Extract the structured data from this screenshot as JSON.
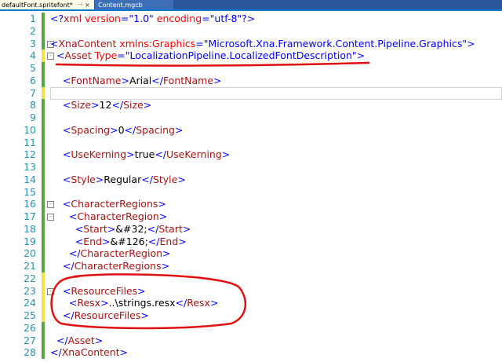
{
  "tabs": [
    {
      "label": "defaultFont.spritefont*",
      "pin": "⊣",
      "close": "×",
      "active": true
    },
    {
      "label": "Content.mgcb",
      "active": false
    }
  ],
  "lines": [
    {
      "n": "1",
      "mark": "saved",
      "parts": [
        [
          "b",
          "<?"
        ],
        [
          "t",
          "xml"
        ],
        [
          "a",
          " version"
        ],
        [
          "b",
          "="
        ],
        [
          "v",
          "\"1.0\""
        ],
        [
          "a",
          " encoding"
        ],
        [
          "b",
          "="
        ],
        [
          "v",
          "\"utf-8\""
        ],
        [
          "b",
          "?>"
        ]
      ]
    },
    {
      "n": "2",
      "mark": "saved",
      "parts": []
    },
    {
      "n": "3",
      "mark": "saved",
      "fold": "-",
      "parts": [
        [
          "b",
          "<"
        ],
        [
          "t",
          "XnaContent"
        ],
        [
          "a",
          " xmlns:Graphics"
        ],
        [
          "b",
          "="
        ],
        [
          "v",
          "\"Microsoft.Xna.Framework.Content.Pipeline.Graphics\""
        ],
        [
          "b",
          ">"
        ]
      ]
    },
    {
      "n": "4",
      "mark": "changed",
      "fold": "-",
      "parts": [
        [
          "b",
          "  <"
        ],
        [
          "t",
          "Asset"
        ],
        [
          "a",
          " Type"
        ],
        [
          "b",
          "="
        ],
        [
          "v",
          "\"LocalizationPipeline.LocalizedFontDescription\""
        ],
        [
          "b",
          ">"
        ]
      ]
    },
    {
      "n": "5",
      "mark": "saved",
      "parts": []
    },
    {
      "n": "6",
      "mark": "saved",
      "parts": [
        [
          "b",
          "    <"
        ],
        [
          "t",
          "FontName"
        ],
        [
          "b",
          ">"
        ],
        [
          "x",
          "Arial"
        ],
        [
          "b",
          "</"
        ],
        [
          "t",
          "FontName"
        ],
        [
          "b",
          ">"
        ]
      ]
    },
    {
      "n": "7",
      "mark": "changed",
      "parts": [],
      "current": true
    },
    {
      "n": "8",
      "mark": "saved",
      "parts": [
        [
          "b",
          "    <"
        ],
        [
          "t",
          "Size"
        ],
        [
          "b",
          ">"
        ],
        [
          "x",
          "12"
        ],
        [
          "b",
          "</"
        ],
        [
          "t",
          "Size"
        ],
        [
          "b",
          ">"
        ]
      ]
    },
    {
      "n": "9",
      "mark": "saved",
      "parts": []
    },
    {
      "n": "10",
      "mark": "saved",
      "parts": [
        [
          "b",
          "    <"
        ],
        [
          "t",
          "Spacing"
        ],
        [
          "b",
          ">"
        ],
        [
          "x",
          "0"
        ],
        [
          "b",
          "</"
        ],
        [
          "t",
          "Spacing"
        ],
        [
          "b",
          ">"
        ]
      ]
    },
    {
      "n": "11",
      "mark": "saved",
      "parts": []
    },
    {
      "n": "12",
      "mark": "saved",
      "parts": [
        [
          "b",
          "    <"
        ],
        [
          "t",
          "UseKerning"
        ],
        [
          "b",
          ">"
        ],
        [
          "x",
          "true"
        ],
        [
          "b",
          "</"
        ],
        [
          "t",
          "UseKerning"
        ],
        [
          "b",
          ">"
        ]
      ]
    },
    {
      "n": "13",
      "mark": "saved",
      "parts": []
    },
    {
      "n": "14",
      "mark": "saved",
      "parts": [
        [
          "b",
          "    <"
        ],
        [
          "t",
          "Style"
        ],
        [
          "b",
          ">"
        ],
        [
          "x",
          "Regular"
        ],
        [
          "b",
          "</"
        ],
        [
          "t",
          "Style"
        ],
        [
          "b",
          ">"
        ]
      ]
    },
    {
      "n": "15",
      "mark": "saved",
      "parts": []
    },
    {
      "n": "16",
      "mark": "saved",
      "fold": "-",
      "parts": [
        [
          "b",
          "    <"
        ],
        [
          "t",
          "CharacterRegions"
        ],
        [
          "b",
          ">"
        ]
      ]
    },
    {
      "n": "17",
      "mark": "saved",
      "fold": "-",
      "parts": [
        [
          "b",
          "      <"
        ],
        [
          "t",
          "CharacterRegion"
        ],
        [
          "b",
          ">"
        ]
      ]
    },
    {
      "n": "18",
      "mark": "saved",
      "parts": [
        [
          "b",
          "        <"
        ],
        [
          "t",
          "Start"
        ],
        [
          "b",
          ">"
        ],
        [
          "x",
          "&#32;"
        ],
        [
          "b",
          "</"
        ],
        [
          "t",
          "Start"
        ],
        [
          "b",
          ">"
        ]
      ]
    },
    {
      "n": "19",
      "mark": "saved",
      "parts": [
        [
          "b",
          "        <"
        ],
        [
          "t",
          "End"
        ],
        [
          "b",
          ">"
        ],
        [
          "x",
          "&#126;"
        ],
        [
          "b",
          "</"
        ],
        [
          "t",
          "End"
        ],
        [
          "b",
          ">"
        ]
      ]
    },
    {
      "n": "20",
      "mark": "saved",
      "parts": [
        [
          "b",
          "      </"
        ],
        [
          "t",
          "CharacterRegion"
        ],
        [
          "b",
          ">"
        ]
      ]
    },
    {
      "n": "21",
      "mark": "saved",
      "parts": [
        [
          "b",
          "    </"
        ],
        [
          "t",
          "CharacterRegions"
        ],
        [
          "b",
          ">"
        ]
      ]
    },
    {
      "n": "22",
      "mark": "changed",
      "parts": []
    },
    {
      "n": "23",
      "mark": "changed",
      "fold": "-",
      "parts": [
        [
          "b",
          "    <"
        ],
        [
          "t",
          "ResourceFiles"
        ],
        [
          "b",
          ">"
        ]
      ]
    },
    {
      "n": "24",
      "mark": "changed",
      "parts": [
        [
          "b",
          "      <"
        ],
        [
          "t",
          "Resx"
        ],
        [
          "b",
          ">"
        ],
        [
          "x",
          "..\\strings.resx"
        ],
        [
          "b",
          "</"
        ],
        [
          "t",
          "Resx"
        ],
        [
          "b",
          ">"
        ]
      ]
    },
    {
      "n": "25",
      "mark": "changed",
      "parts": [
        [
          "b",
          "    </"
        ],
        [
          "t",
          "ResourceFiles"
        ],
        [
          "b",
          ">"
        ]
      ]
    },
    {
      "n": "26",
      "mark": "saved",
      "parts": []
    },
    {
      "n": "27",
      "mark": "saved",
      "parts": [
        [
          "b",
          "  </"
        ],
        [
          "t",
          "Asset"
        ],
        [
          "b",
          ">"
        ]
      ]
    },
    {
      "n": "28",
      "mark": "saved",
      "parts": [
        [
          "b",
          "</"
        ],
        [
          "t",
          "XnaContent"
        ],
        [
          "b",
          ">"
        ]
      ]
    }
  ]
}
